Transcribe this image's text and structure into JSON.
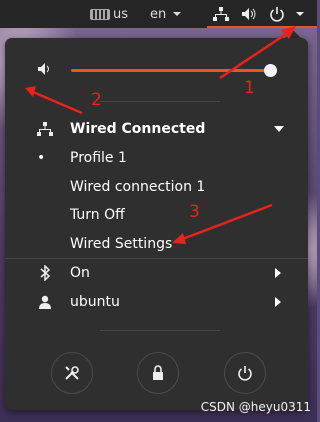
{
  "topbar": {
    "keyboard_label": "us",
    "language_label": "en",
    "accent": "#e95420"
  },
  "menu": {
    "volume": {
      "level": 0.97
    },
    "network": {
      "title": "Wired Connected",
      "items": [
        "Profile 1",
        "Wired connection 1",
        "Turn Off",
        "Wired Settings"
      ],
      "active_marker": "•"
    },
    "bluetooth": {
      "label": "On"
    },
    "user": {
      "label": "ubuntu"
    },
    "buttons": [
      "settings",
      "lock",
      "power"
    ]
  },
  "annotations": {
    "numbers": [
      "1",
      "2",
      "3"
    ],
    "color": "#e8231a"
  },
  "watermark": "CSDN @heyu0311"
}
